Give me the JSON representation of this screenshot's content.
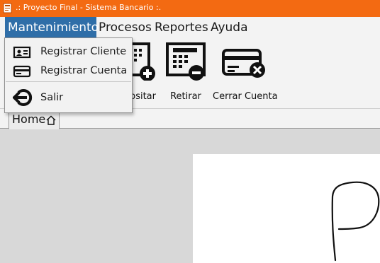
{
  "window": {
    "title": ".: Proyecto Final - Sistema Bancario :.",
    "icon": "app-icon"
  },
  "colors": {
    "titlebar": "#f36a12",
    "menu_active": "#2f6ea8",
    "background": "#dcdcdc"
  },
  "menubar": {
    "items": [
      {
        "label": "Mantenimiento",
        "active": true
      },
      {
        "label": "Procesos"
      },
      {
        "label": "Reportes"
      },
      {
        "label": "Ayuda"
      }
    ]
  },
  "dropdown": {
    "items": [
      {
        "label": "Registrar Cliente",
        "icon": "id-card-icon"
      },
      {
        "label": "Registrar Cuenta",
        "icon": "credit-card-icon"
      },
      {
        "label": "Salir",
        "icon": "exit-icon"
      }
    ]
  },
  "toolbar": {
    "buttons": [
      {
        "label": "Depositar",
        "icon": "calculator-plus-icon"
      },
      {
        "label": "Retirar",
        "icon": "calculator-minus-icon"
      },
      {
        "label": "Cerrar Cuenta",
        "icon": "card-close-icon"
      }
    ]
  },
  "tabs": [
    {
      "label": "Home",
      "icon": "home-icon"
    }
  ]
}
